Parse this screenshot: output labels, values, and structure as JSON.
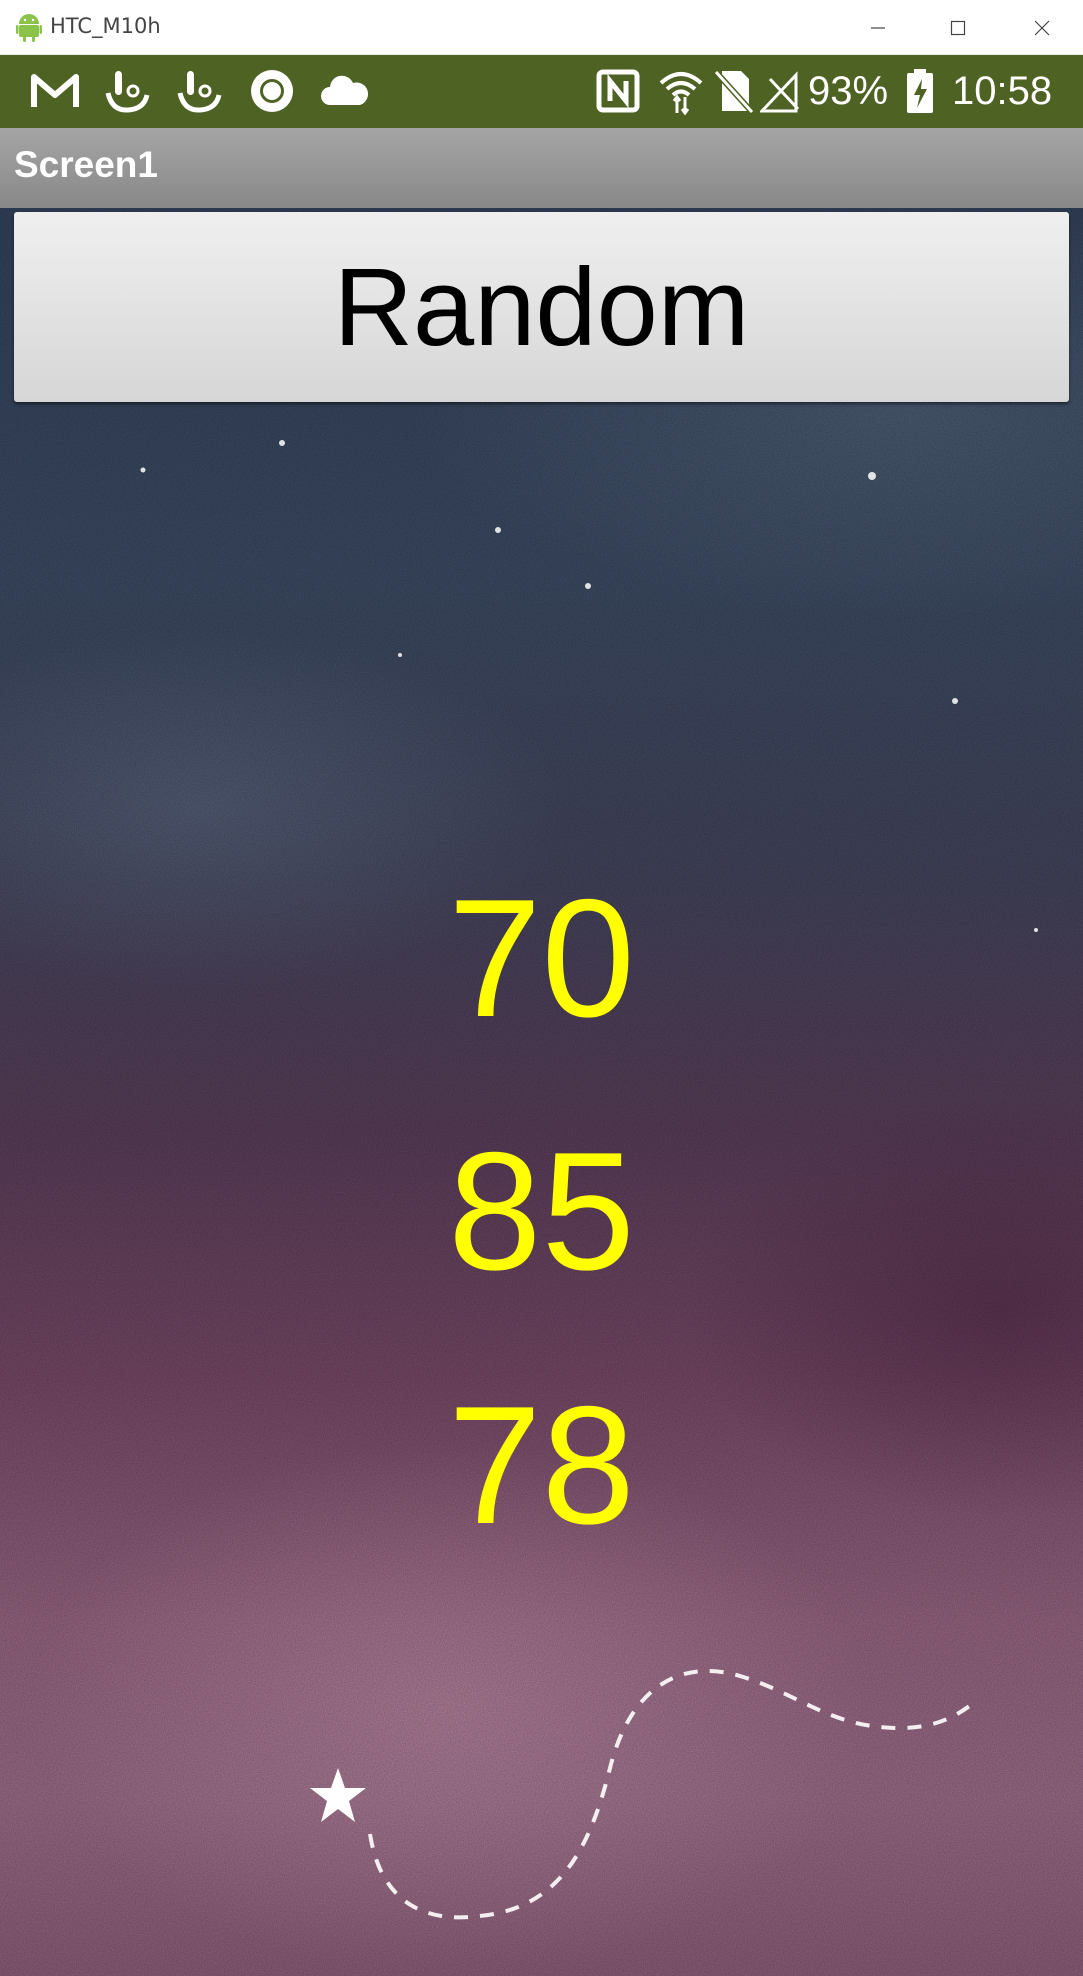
{
  "window": {
    "title": "HTC_M10h",
    "controls": [
      "minimize-icon",
      "maximize-icon",
      "close-icon"
    ]
  },
  "status_bar": {
    "left_icons": [
      "gmail-icon",
      "touchpal-icon",
      "touchpal-icon",
      "circle-icon",
      "cloud-icon"
    ],
    "right_icons": [
      "nfc-icon",
      "wifi-icon",
      "no-sim-icon",
      "signal-icon",
      "battery-charging-icon"
    ],
    "battery": "93%",
    "time": "10:58",
    "background_color": "#4e6223"
  },
  "action_bar": {
    "title": "Screen1"
  },
  "main": {
    "button_label": "Random",
    "numbers": [
      "70",
      "85",
      "78"
    ],
    "number_color": "#ffff00"
  }
}
